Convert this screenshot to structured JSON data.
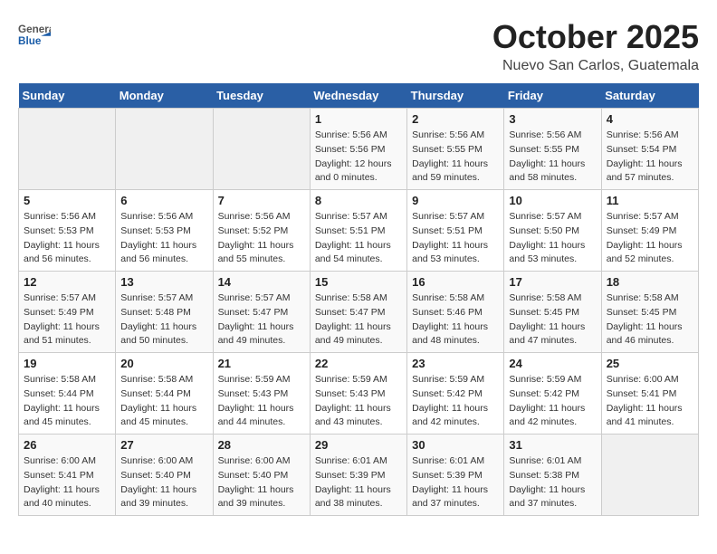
{
  "header": {
    "logo_general": "General",
    "logo_blue": "Blue",
    "month_title": "October 2025",
    "location": "Nuevo San Carlos, Guatemala"
  },
  "weekdays": [
    "Sunday",
    "Monday",
    "Tuesday",
    "Wednesday",
    "Thursday",
    "Friday",
    "Saturday"
  ],
  "weeks": [
    [
      {
        "day": "",
        "info": ""
      },
      {
        "day": "",
        "info": ""
      },
      {
        "day": "",
        "info": ""
      },
      {
        "day": "1",
        "info": "Sunrise: 5:56 AM\nSunset: 5:56 PM\nDaylight: 12 hours\nand 0 minutes."
      },
      {
        "day": "2",
        "info": "Sunrise: 5:56 AM\nSunset: 5:55 PM\nDaylight: 11 hours\nand 59 minutes."
      },
      {
        "day": "3",
        "info": "Sunrise: 5:56 AM\nSunset: 5:55 PM\nDaylight: 11 hours\nand 58 minutes."
      },
      {
        "day": "4",
        "info": "Sunrise: 5:56 AM\nSunset: 5:54 PM\nDaylight: 11 hours\nand 57 minutes."
      }
    ],
    [
      {
        "day": "5",
        "info": "Sunrise: 5:56 AM\nSunset: 5:53 PM\nDaylight: 11 hours\nand 56 minutes."
      },
      {
        "day": "6",
        "info": "Sunrise: 5:56 AM\nSunset: 5:53 PM\nDaylight: 11 hours\nand 56 minutes."
      },
      {
        "day": "7",
        "info": "Sunrise: 5:56 AM\nSunset: 5:52 PM\nDaylight: 11 hours\nand 55 minutes."
      },
      {
        "day": "8",
        "info": "Sunrise: 5:57 AM\nSunset: 5:51 PM\nDaylight: 11 hours\nand 54 minutes."
      },
      {
        "day": "9",
        "info": "Sunrise: 5:57 AM\nSunset: 5:51 PM\nDaylight: 11 hours\nand 53 minutes."
      },
      {
        "day": "10",
        "info": "Sunrise: 5:57 AM\nSunset: 5:50 PM\nDaylight: 11 hours\nand 53 minutes."
      },
      {
        "day": "11",
        "info": "Sunrise: 5:57 AM\nSunset: 5:49 PM\nDaylight: 11 hours\nand 52 minutes."
      }
    ],
    [
      {
        "day": "12",
        "info": "Sunrise: 5:57 AM\nSunset: 5:49 PM\nDaylight: 11 hours\nand 51 minutes."
      },
      {
        "day": "13",
        "info": "Sunrise: 5:57 AM\nSunset: 5:48 PM\nDaylight: 11 hours\nand 50 minutes."
      },
      {
        "day": "14",
        "info": "Sunrise: 5:57 AM\nSunset: 5:47 PM\nDaylight: 11 hours\nand 49 minutes."
      },
      {
        "day": "15",
        "info": "Sunrise: 5:58 AM\nSunset: 5:47 PM\nDaylight: 11 hours\nand 49 minutes."
      },
      {
        "day": "16",
        "info": "Sunrise: 5:58 AM\nSunset: 5:46 PM\nDaylight: 11 hours\nand 48 minutes."
      },
      {
        "day": "17",
        "info": "Sunrise: 5:58 AM\nSunset: 5:45 PM\nDaylight: 11 hours\nand 47 minutes."
      },
      {
        "day": "18",
        "info": "Sunrise: 5:58 AM\nSunset: 5:45 PM\nDaylight: 11 hours\nand 46 minutes."
      }
    ],
    [
      {
        "day": "19",
        "info": "Sunrise: 5:58 AM\nSunset: 5:44 PM\nDaylight: 11 hours\nand 45 minutes."
      },
      {
        "day": "20",
        "info": "Sunrise: 5:58 AM\nSunset: 5:44 PM\nDaylight: 11 hours\nand 45 minutes."
      },
      {
        "day": "21",
        "info": "Sunrise: 5:59 AM\nSunset: 5:43 PM\nDaylight: 11 hours\nand 44 minutes."
      },
      {
        "day": "22",
        "info": "Sunrise: 5:59 AM\nSunset: 5:43 PM\nDaylight: 11 hours\nand 43 minutes."
      },
      {
        "day": "23",
        "info": "Sunrise: 5:59 AM\nSunset: 5:42 PM\nDaylight: 11 hours\nand 42 minutes."
      },
      {
        "day": "24",
        "info": "Sunrise: 5:59 AM\nSunset: 5:42 PM\nDaylight: 11 hours\nand 42 minutes."
      },
      {
        "day": "25",
        "info": "Sunrise: 6:00 AM\nSunset: 5:41 PM\nDaylight: 11 hours\nand 41 minutes."
      }
    ],
    [
      {
        "day": "26",
        "info": "Sunrise: 6:00 AM\nSunset: 5:41 PM\nDaylight: 11 hours\nand 40 minutes."
      },
      {
        "day": "27",
        "info": "Sunrise: 6:00 AM\nSunset: 5:40 PM\nDaylight: 11 hours\nand 39 minutes."
      },
      {
        "day": "28",
        "info": "Sunrise: 6:00 AM\nSunset: 5:40 PM\nDaylight: 11 hours\nand 39 minutes."
      },
      {
        "day": "29",
        "info": "Sunrise: 6:01 AM\nSunset: 5:39 PM\nDaylight: 11 hours\nand 38 minutes."
      },
      {
        "day": "30",
        "info": "Sunrise: 6:01 AM\nSunset: 5:39 PM\nDaylight: 11 hours\nand 37 minutes."
      },
      {
        "day": "31",
        "info": "Sunrise: 6:01 AM\nSunset: 5:38 PM\nDaylight: 11 hours\nand 37 minutes."
      },
      {
        "day": "",
        "info": ""
      }
    ]
  ]
}
